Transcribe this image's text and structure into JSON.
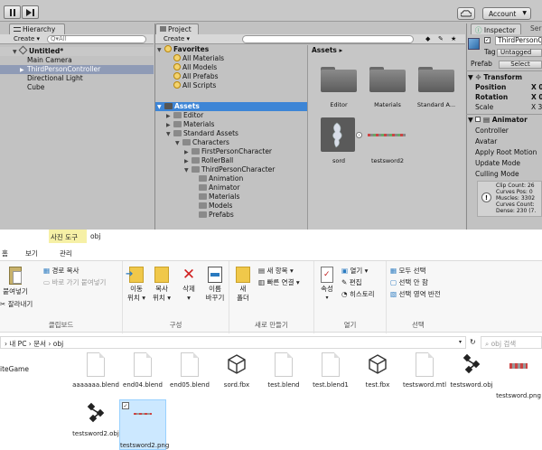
{
  "unity": {
    "hierarchy": {
      "tab": "Hierarchy",
      "create": "Create",
      "search_placeholder": "Q▾All",
      "scene": "Untitled*",
      "items": [
        "Main Camera",
        "ThirdPersonController",
        "Directional Light",
        "Cube"
      ]
    },
    "project": {
      "tab": "Project",
      "create": "Create",
      "favorites": {
        "title": "Favorites",
        "items": [
          "All Materials",
          "All Models",
          "All Prefabs",
          "All Scripts"
        ]
      },
      "assets_root": "Assets",
      "tree": {
        "editor": "Editor",
        "materials": "Materials",
        "standard_assets": "Standard Assets",
        "characters": "Characters",
        "first_person": "FirstPersonCharacter",
        "rollerball": "RollerBall",
        "third_person": "ThirdPersonCharacter",
        "sub": [
          "Animation",
          "Animator",
          "Materials",
          "Models",
          "Prefabs"
        ]
      },
      "breadcrumb": "Assets ▸",
      "grid": [
        "Editor",
        "Materials",
        "Standard A...",
        "sord",
        "testsword2"
      ]
    },
    "inspector": {
      "tab": "Inspector",
      "tab2": "Ser",
      "object_name": "ThirdPersonCo",
      "tag_label": "Tag",
      "tag_value": "Untagged",
      "prefab_label": "Prefab",
      "prefab_select": "Select",
      "transform_title": "Transform",
      "transform_rows": [
        [
          "Position",
          "X 0"
        ],
        [
          "Rotation",
          "X 0"
        ],
        [
          "Scale",
          "X 3"
        ]
      ],
      "animator_title": "Animator",
      "animator_rows": [
        "Controller",
        "Avatar",
        "Apply Root Motion",
        "Update Mode",
        "Culling Mode"
      ],
      "info_lines": [
        "Clip Count: 26",
        "Curves Pos: 0",
        "Muscles: 3302",
        "Curves Count:",
        "Dense: 230 (7."
      ]
    }
  },
  "explorer": {
    "tabs": {
      "file": "",
      "home": "홈",
      "share": "보기",
      "context_group": "사진 도구",
      "context_tab": "관리",
      "title": "obj"
    },
    "ribbon": {
      "clipboard": {
        "paste": "붙여넣기",
        "copy_path": "경로 복사",
        "paste_shortcut": "바로 가기 붙여넣기",
        "cut": "잘라내기",
        "name": "클립보드"
      },
      "organize": {
        "move": "이동\n위치 ▾",
        "copy": "복사\n위치 ▾",
        "delete": "삭제\n▾",
        "rename": "이름\n바꾸기",
        "name": "구성"
      },
      "new": {
        "folder": "새\n폴더",
        "item": "새 항목 ▾",
        "easy": "빠른 연결 ▾",
        "name": "새로 만들기"
      },
      "open": {
        "props": "속성",
        "open": "열기 ▾",
        "edit": "편집",
        "history": "히스토리",
        "name": "열기"
      },
      "select": {
        "all": "모두 선택",
        "none": "선택 안 함",
        "invert": "선택 영역 반전",
        "name": "선택"
      }
    },
    "address": {
      "path": "› 내 PC › 문서 › obj",
      "search": "obj 검색"
    },
    "nav": [
      "iteGame"
    ],
    "files_row1": [
      "aaaaaaa.blend",
      "end04.blend",
      "end05.blend",
      "sord.fbx",
      "test.blend",
      "test.blend1",
      "test.fbx",
      "testsword.mtl",
      "testsword.obj",
      "testsword.png"
    ],
    "files_row2": [
      "testsword2.obj",
      "testsword2.png"
    ]
  }
}
